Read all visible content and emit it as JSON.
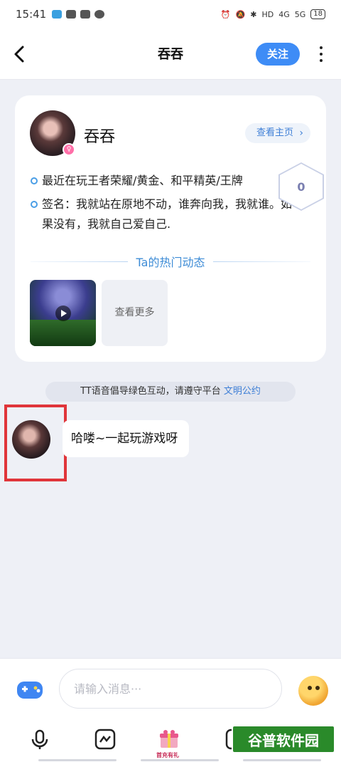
{
  "status_bar": {
    "time": "15:41",
    "network_labels": [
      "HD",
      "4G",
      "5G"
    ],
    "battery": "18"
  },
  "header": {
    "title": "吞吞",
    "follow_label": "关注"
  },
  "profile": {
    "name": "吞吞",
    "view_home_label": "查看主页",
    "recent_games": "最近在玩王者荣耀/黄金、和平精英/王牌",
    "signature": "签名：我就站在原地不动，谁奔向我，我就谁。如果没有，我就自己爱自己.",
    "hex_counter": "0",
    "section_title": "Ta的热门动态",
    "see_more_label": "查看更多"
  },
  "notice": {
    "text": "TT语音倡导绿色互动，请遵守平台",
    "link": "文明公约"
  },
  "messages": [
    {
      "text": "哈喽~一起玩游戏呀"
    }
  ],
  "input": {
    "placeholder": "请输入消息···"
  },
  "toolbar": {
    "gift_label": "首充有礼"
  },
  "watermark": "谷普软件园",
  "colors": {
    "accent": "#3e8cf6",
    "link": "#3e7fd6",
    "highlight_box": "#e0353a"
  }
}
